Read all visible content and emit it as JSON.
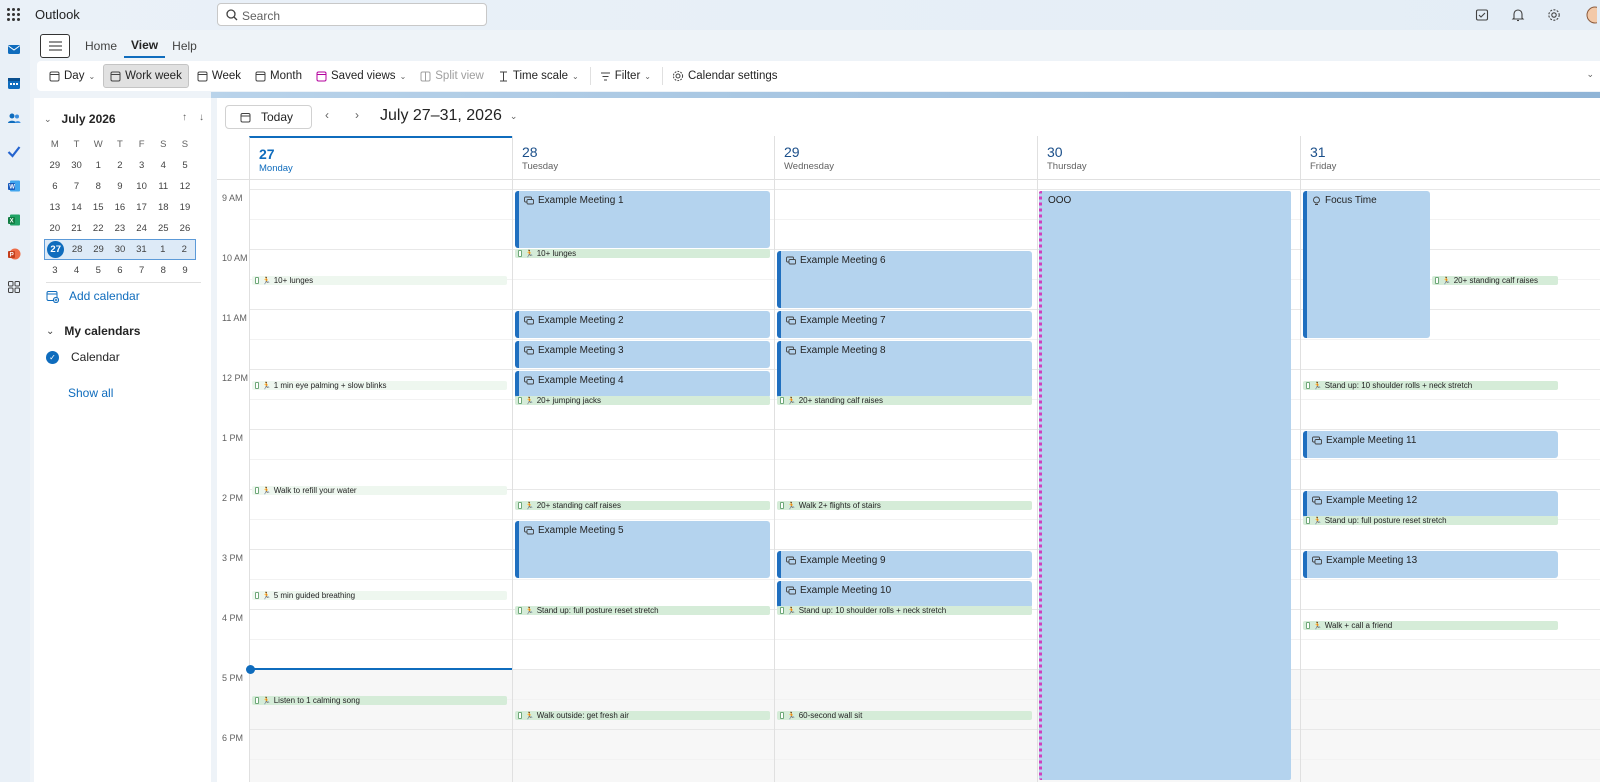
{
  "app": {
    "title": "Outlook"
  },
  "search": {
    "placeholder": "Search"
  },
  "ribbon": {
    "tabs": [
      {
        "label": "Home"
      },
      {
        "label": "View"
      },
      {
        "label": "Help"
      }
    ]
  },
  "toolbar": {
    "day": "Day",
    "work_week": "Work week",
    "week": "Week",
    "month": "Month",
    "saved_views": "Saved views",
    "split_view": "Split view",
    "time_scale": "Time scale",
    "filter": "Filter",
    "calendar_settings": "Calendar settings"
  },
  "mini_calendar": {
    "month_label": "July 2026",
    "dow": [
      "M",
      "T",
      "W",
      "T",
      "F",
      "S",
      "S"
    ],
    "weeks": [
      [
        "29",
        "30",
        "1",
        "2",
        "3",
        "4",
        "5"
      ],
      [
        "6",
        "7",
        "8",
        "9",
        "10",
        "11",
        "12"
      ],
      [
        "13",
        "14",
        "15",
        "16",
        "17",
        "18",
        "19"
      ],
      [
        "20",
        "21",
        "22",
        "23",
        "24",
        "25",
        "26"
      ],
      [
        "27",
        "28",
        "29",
        "30",
        "31",
        "1",
        "2"
      ],
      [
        "3",
        "4",
        "5",
        "6",
        "7",
        "8",
        "9"
      ]
    ]
  },
  "sidebar": {
    "add_calendar": "Add calendar",
    "my_calendars": "My calendars",
    "calendar_name": "Calendar",
    "show_all": "Show all"
  },
  "calendar": {
    "today_label": "Today",
    "range_title": "July 27–31, 2026",
    "days": [
      {
        "num": "27",
        "name": "Monday"
      },
      {
        "num": "28",
        "name": "Tuesday"
      },
      {
        "num": "29",
        "name": "Wednesday"
      },
      {
        "num": "30",
        "name": "Thursday"
      },
      {
        "num": "31",
        "name": "Friday"
      }
    ],
    "hours": [
      "9 AM",
      "10 AM",
      "11 AM",
      "12 PM",
      "1 PM",
      "2 PM",
      "3 PM",
      "4 PM",
      "5 PM",
      "6 PM"
    ],
    "events": [
      {
        "day": 1,
        "start": 9.0,
        "end": 10.0,
        "title": "Example Meeting 1"
      },
      {
        "day": 1,
        "start": 11.0,
        "end": 11.5,
        "title": "Example Meeting 2"
      },
      {
        "day": 1,
        "start": 11.5,
        "end": 12.0,
        "title": "Example Meeting 3"
      },
      {
        "day": 1,
        "start": 12.0,
        "end": 12.5,
        "title": "Example Meeting 4"
      },
      {
        "day": 1,
        "start": 14.5,
        "end": 15.5,
        "title": "Example Meeting 5"
      },
      {
        "day": 2,
        "start": 10.0,
        "end": 11.0,
        "title": "Example Meeting 6"
      },
      {
        "day": 2,
        "start": 11.0,
        "end": 11.5,
        "title": "Example Meeting 7"
      },
      {
        "day": 2,
        "start": 11.5,
        "end": 12.5,
        "title": "Example Meeting 8"
      },
      {
        "day": 2,
        "start": 15.0,
        "end": 15.5,
        "title": "Example Meeting 9"
      },
      {
        "day": 2,
        "start": 15.5,
        "end": 16.0,
        "title": "Example Meeting 10"
      },
      {
        "day": 4,
        "start": 13.0,
        "end": 13.5,
        "title": "Example Meeting 11"
      },
      {
        "day": 4,
        "start": 14.0,
        "end": 14.5,
        "title": "Example Meeting 12"
      },
      {
        "day": 4,
        "start": 15.0,
        "end": 15.5,
        "title": "Example Meeting 13"
      }
    ],
    "focus": {
      "day": 4,
      "start": 9.0,
      "end": 11.5,
      "title": "Focus Time"
    },
    "ooo": {
      "day": 3,
      "start": 9.0,
      "end": 18.0,
      "title": "OOO"
    },
    "tasks": [
      {
        "day": 0,
        "time": 10.45,
        "title": "10+ lunges",
        "pale": true
      },
      {
        "day": 0,
        "time": 12.2,
        "title": "1 min eye palming + slow blinks",
        "pale": true
      },
      {
        "day": 0,
        "time": 13.95,
        "title": "Walk to refill your water",
        "pale": true
      },
      {
        "day": 0,
        "time": 15.7,
        "title": "5 min guided breathing",
        "pale": true
      },
      {
        "day": 0,
        "time": 17.45,
        "title": "Listen to 1 calming song",
        "pale": false
      },
      {
        "day": 1,
        "time": 10.0,
        "title": "10+ lunges",
        "pale": false
      },
      {
        "day": 1,
        "time": 12.45,
        "title": "20+ jumping jacks",
        "pale": false
      },
      {
        "day": 1,
        "time": 14.2,
        "title": "20+ standing calf raises",
        "pale": false
      },
      {
        "day": 1,
        "time": 15.95,
        "title": "Stand up: full posture reset stretch",
        "pale": false
      },
      {
        "day": 1,
        "time": 17.7,
        "title": "Walk outside: get fresh air",
        "pale": false
      },
      {
        "day": 2,
        "time": 12.45,
        "title": "20+ standing calf raises",
        "pale": false
      },
      {
        "day": 2,
        "time": 14.2,
        "title": "Walk 2+ flights of stairs",
        "pale": false
      },
      {
        "day": 2,
        "time": 15.95,
        "title": "Stand up: 10 shoulder rolls + neck stretch",
        "pale": false
      },
      {
        "day": 2,
        "time": 17.7,
        "title": "60-second wall sit",
        "pale": false
      },
      {
        "day": 4,
        "time": 10.45,
        "title": "20+ standing calf raises",
        "pale": false,
        "right": true
      },
      {
        "day": 4,
        "time": 12.2,
        "title": "Stand up: 10 shoulder rolls + neck stretch",
        "pale": false
      },
      {
        "day": 4,
        "time": 14.45,
        "title": "Stand up: full posture reset stretch",
        "pale": false
      },
      {
        "day": 4,
        "time": 16.2,
        "title": "Walk + call a friend",
        "pale": false
      }
    ],
    "now_time": 17.0
  }
}
